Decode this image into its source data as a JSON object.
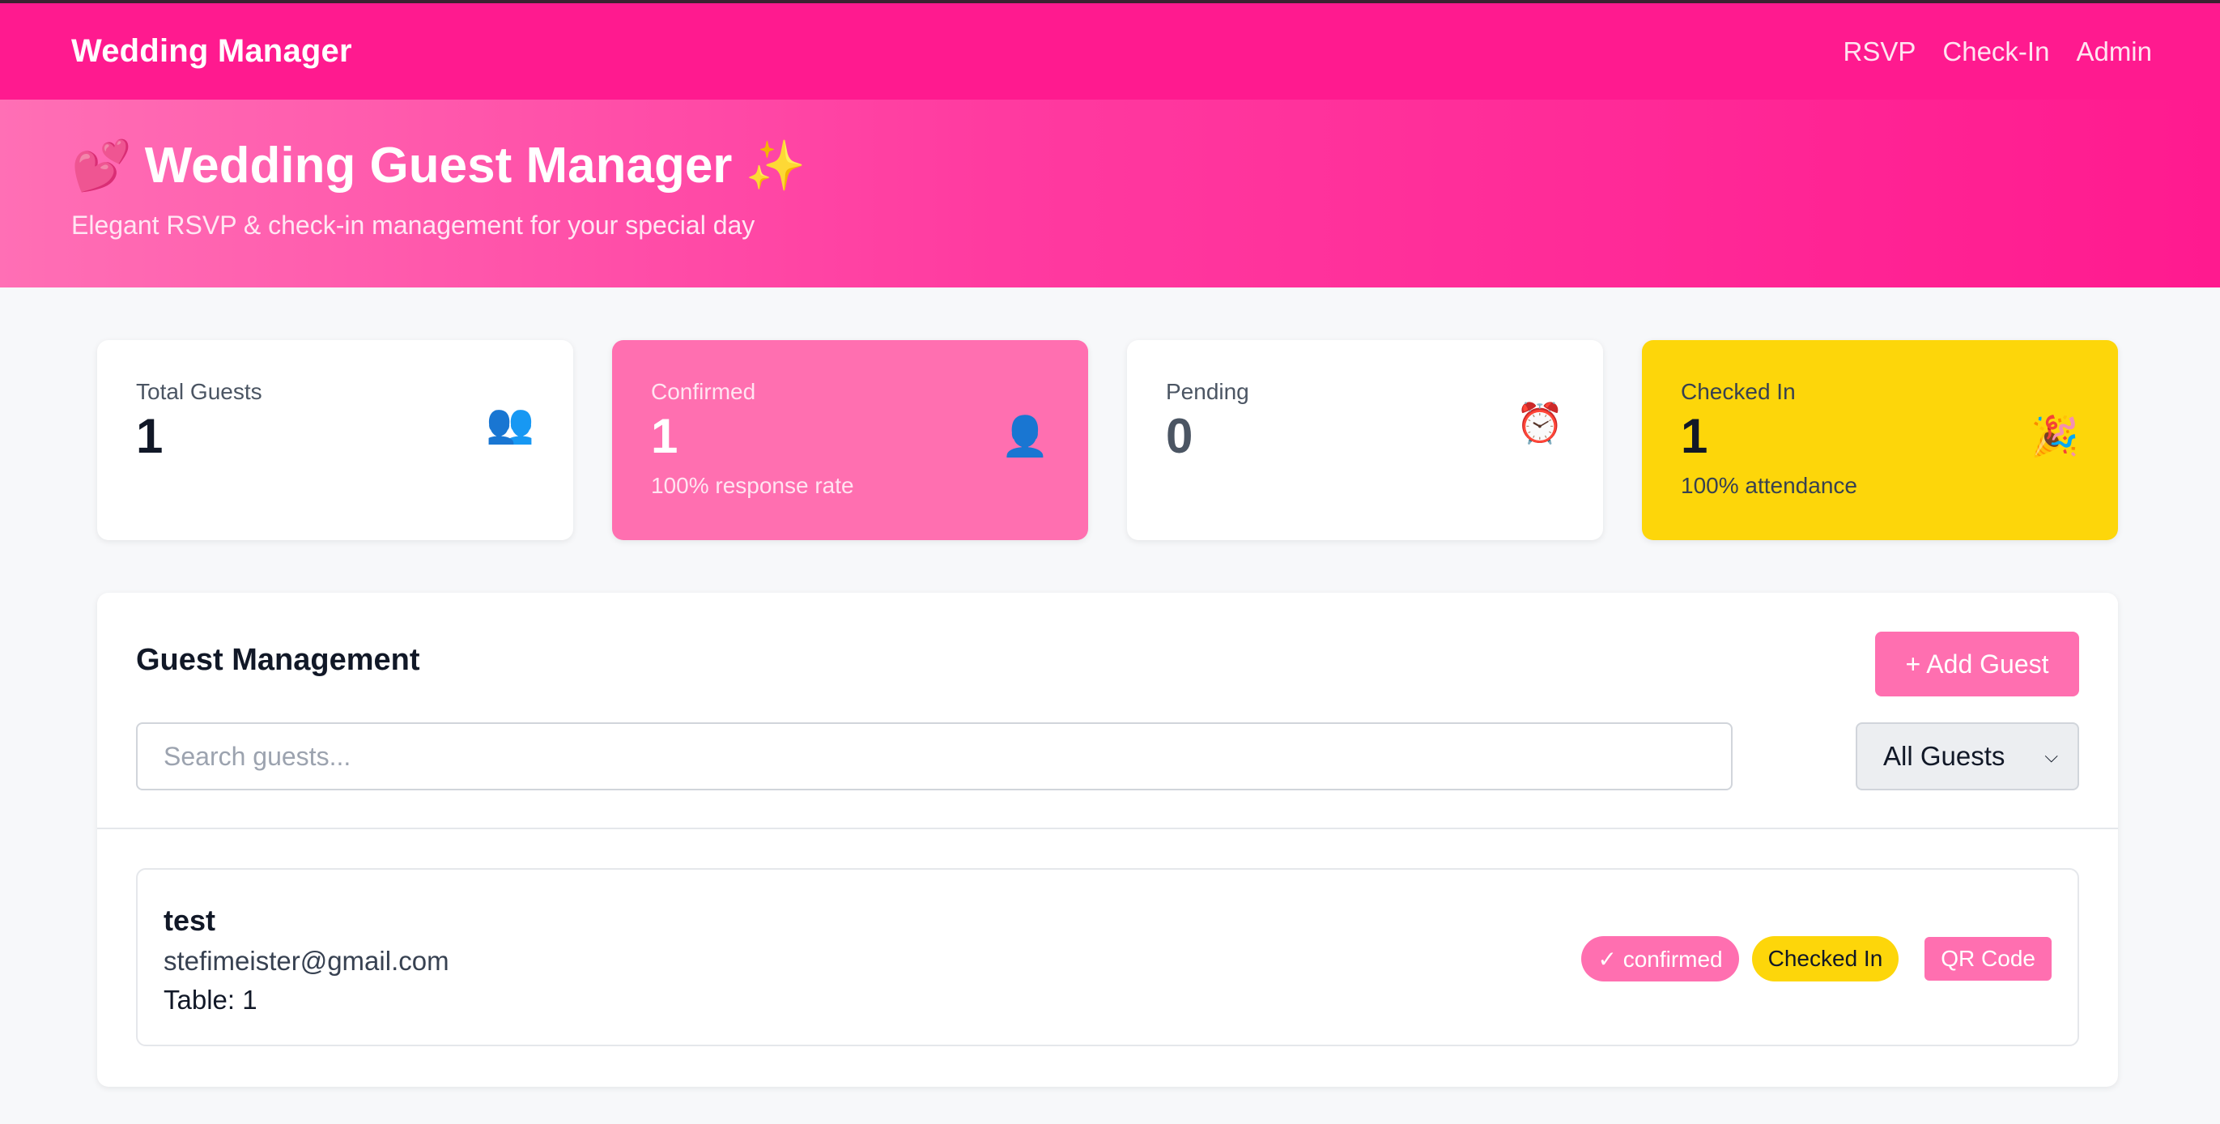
{
  "navbar": {
    "brand": "Wedding Manager",
    "links": [
      "RSVP",
      "Check-In",
      "Admin"
    ]
  },
  "hero": {
    "emoji_left": "💕",
    "title": "Wedding Guest Manager",
    "emoji_right": "✨",
    "subtitle": "Elegant RSVP & check-in management for your special day"
  },
  "stats": [
    {
      "label": "Total Guests",
      "value": "1",
      "sub": "",
      "icon": "👥",
      "icon_name": "people-icon"
    },
    {
      "label": "Confirmed",
      "value": "1",
      "sub": "100% response rate",
      "icon": "👤",
      "icon_name": "person-icon"
    },
    {
      "label": "Pending",
      "value": "0",
      "sub": "",
      "icon": "⏰",
      "icon_name": "alarm-clock-icon"
    },
    {
      "label": "Checked In",
      "value": "1",
      "sub": "100% attendance",
      "icon": "🎉",
      "icon_name": "party-popper-icon"
    }
  ],
  "management": {
    "title": "Guest Management",
    "add_button": "+ Add Guest",
    "search_placeholder": "Search guests...",
    "search_value": "",
    "filter_selected": "All Guests"
  },
  "guests": [
    {
      "name": "test",
      "email": "stefimeister@gmail.com",
      "table": "Table: 1",
      "status": "✓ confirmed",
      "checkin": "Checked In",
      "qr_label": "QR Code"
    }
  ],
  "colors": {
    "primary_pink": "#ff1a8f",
    "accent_pink": "#ff6fb0",
    "yellow": "#fdd60a"
  }
}
